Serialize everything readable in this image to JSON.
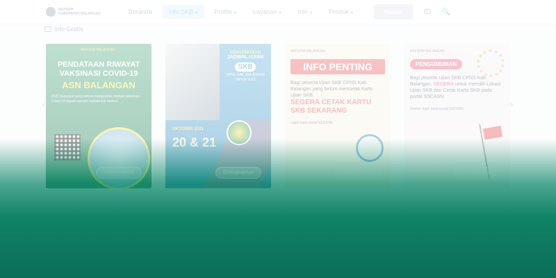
{
  "navbar": {
    "logo_lines": [
      "BKPSDM",
      "KABUPATEN BALANGAN"
    ],
    "items": [
      {
        "label": "Beranda",
        "active": false,
        "has_caret": false
      },
      {
        "label": "Info SKB",
        "active": true,
        "has_caret": true
      },
      {
        "label": "Profile",
        "active": false,
        "has_caret": true
      },
      {
        "label": "Layanan",
        "active": false,
        "has_caret": true
      },
      {
        "label": "Info",
        "active": false,
        "has_caret": true
      },
      {
        "label": "Produk",
        "active": false,
        "has_caret": true
      }
    ],
    "cta_label": "Masuk",
    "lang_label": "ID",
    "search_icon": "search-icon"
  },
  "section": {
    "title": "Info Grafis"
  },
  "carousel": {
    "cards": [
      {
        "badge": "BKPSDM BALANGAN",
        "heading": "PENDATAAN RIWAYAT VAKSINASI COVID-19",
        "subheading": "ASN BALANGAN",
        "body": "ASN Balangan yang belum melaporkan riwayat vaksinasi Covid-19 dapat mengisi melalui link berikut",
        "button": "Selengkapnya"
      },
      {
        "top_label": "PENGUMUMAN",
        "title_line": "JADWAL UJIAN",
        "highlight": "SKB",
        "sub_title": "CPNS KAB. BALANGAN TAHUN 2021",
        "date_label": "OKTOBER 2021",
        "date": "20 & 21",
        "button": "Selengkapnya"
      },
      {
        "kop": "BKPSDM BALANGAN",
        "banner": "INFO PENTING",
        "intro": "Bagi peserta Ujian SKB CPNS Kab. Balangan yang belum mencetak Kartu Ujian SKB,",
        "emphasis": "SEGERA CETAK KARTU SKB SEKARANG",
        "small": "Login pada portal SSCASN",
        "button": "Selengkapnya"
      },
      {
        "kop": "BKPSDM BALANGAN",
        "pill": "PENGUMUMAN",
        "intro": "Bagi peserta Ujian SKB CPNS Kab. Balangan,",
        "emphasis": "SEGERA",
        "rest": "untuk memilih Lokasi Ujian SKB dan Cetak Kartu SKB pada portal SSCASN.",
        "small": "Silakan login pada portal SSCASN",
        "button": "Selengkapnya"
      }
    ],
    "prev_icon": "chevron-left-icon",
    "next_icon": "chevron-right-icon"
  },
  "colors": {
    "nav_accent": "#4aa4d6",
    "card1_bg": "#2e9a6a",
    "card2_bg": "#4aa6d6",
    "card3_banner": "#e0484c",
    "card4_pill": "#e84a6a",
    "footer_green": "#0b6e58"
  }
}
